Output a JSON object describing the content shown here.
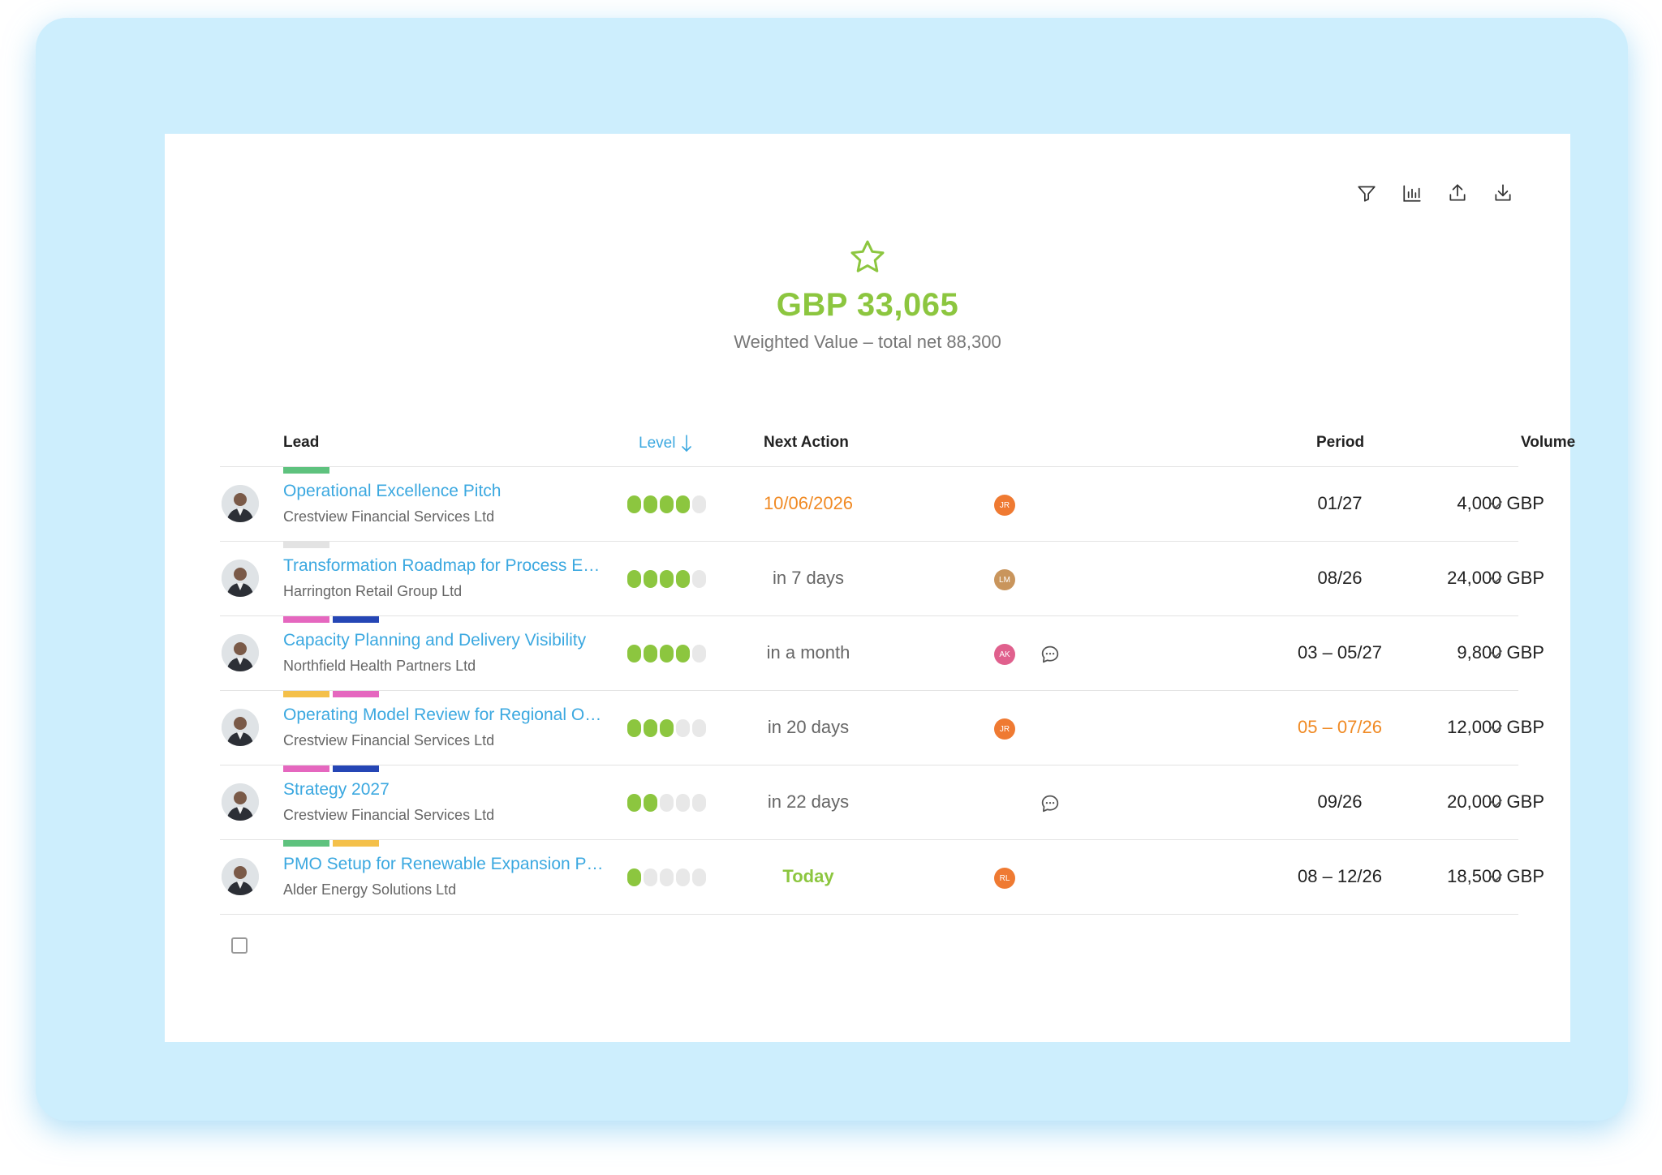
{
  "colors": {
    "accent": "#8cc63f",
    "link": "#3ba8e0",
    "warning": "#f08a24",
    "frame": "#cdeefd"
  },
  "toolbar": {
    "icons": [
      "filter-icon",
      "chart-icon",
      "upload-icon",
      "download-icon"
    ]
  },
  "summary": {
    "icon": "star-icon",
    "value": "GBP 33,065",
    "subtitle": "Weighted Value – total net 88,300"
  },
  "table": {
    "headers": {
      "lead": "Lead",
      "level": "Level",
      "next_action": "Next Action",
      "period": "Period",
      "volume": "Volume"
    },
    "rows": [
      {
        "title": "Operational Excellence Pitch",
        "company": "Crestview Financial Services Ltd",
        "tags": [
          "#5ec27e"
        ],
        "level": 4,
        "next_action": "10/06/2026",
        "next_action_style": "orange",
        "owner_initials": "JR",
        "owner_color": "#ef7a32",
        "has_comment": false,
        "period": "01/27",
        "period_style": "",
        "volume": "4,000 GBP"
      },
      {
        "title": "Transformation Roadmap for Process Excellence",
        "company": "Harrington Retail Group Ltd",
        "tags": [
          "#e3e3e3"
        ],
        "level": 4,
        "next_action": "in 7 days",
        "next_action_style": "",
        "owner_initials": "LM",
        "owner_color": "#c9955c",
        "has_comment": false,
        "period": "08/26",
        "period_style": "",
        "volume": "24,000 GBP"
      },
      {
        "title": "Capacity Planning and Delivery Visibility",
        "company": "Northfield Health Partners Ltd",
        "tags": [
          "#e567bf",
          "#2546b5"
        ],
        "level": 4,
        "next_action": "in a month",
        "next_action_style": "",
        "owner_initials": "AK",
        "owner_color": "#e0608d",
        "has_comment": true,
        "period": "03 – 05/27",
        "period_style": "",
        "volume": "9,800 GBP"
      },
      {
        "title": "Operating Model Review for Regional Operations",
        "company": "Crestview Financial Services Ltd",
        "tags": [
          "#f4c04a",
          "#e567bf"
        ],
        "level": 3,
        "next_action": "in 20 days",
        "next_action_style": "",
        "owner_initials": "JR",
        "owner_color": "#ef7a32",
        "has_comment": false,
        "period": "05 – 07/26",
        "period_style": "orange",
        "volume": "12,000 GBP"
      },
      {
        "title": "Strategy 2027",
        "company": "Crestview Financial Services Ltd",
        "tags": [
          "#e567bf",
          "#2546b5"
        ],
        "level": 2,
        "next_action": "in 22 days",
        "next_action_style": "",
        "owner_initials": "",
        "owner_color": "",
        "has_comment": true,
        "period": "09/26",
        "period_style": "",
        "volume": "20,000 GBP"
      },
      {
        "title": "PMO Setup for Renewable Expansion Programme",
        "company": "Alder Energy Solutions Ltd",
        "tags": [
          "#5ec27e",
          "#f4c04a"
        ],
        "level": 1,
        "next_action": "Today",
        "next_action_style": "green",
        "owner_initials": "RL",
        "owner_color": "#ef7a32",
        "has_comment": false,
        "period": "08 – 12/26",
        "period_style": "",
        "volume": "18,500 GBP"
      }
    ]
  }
}
